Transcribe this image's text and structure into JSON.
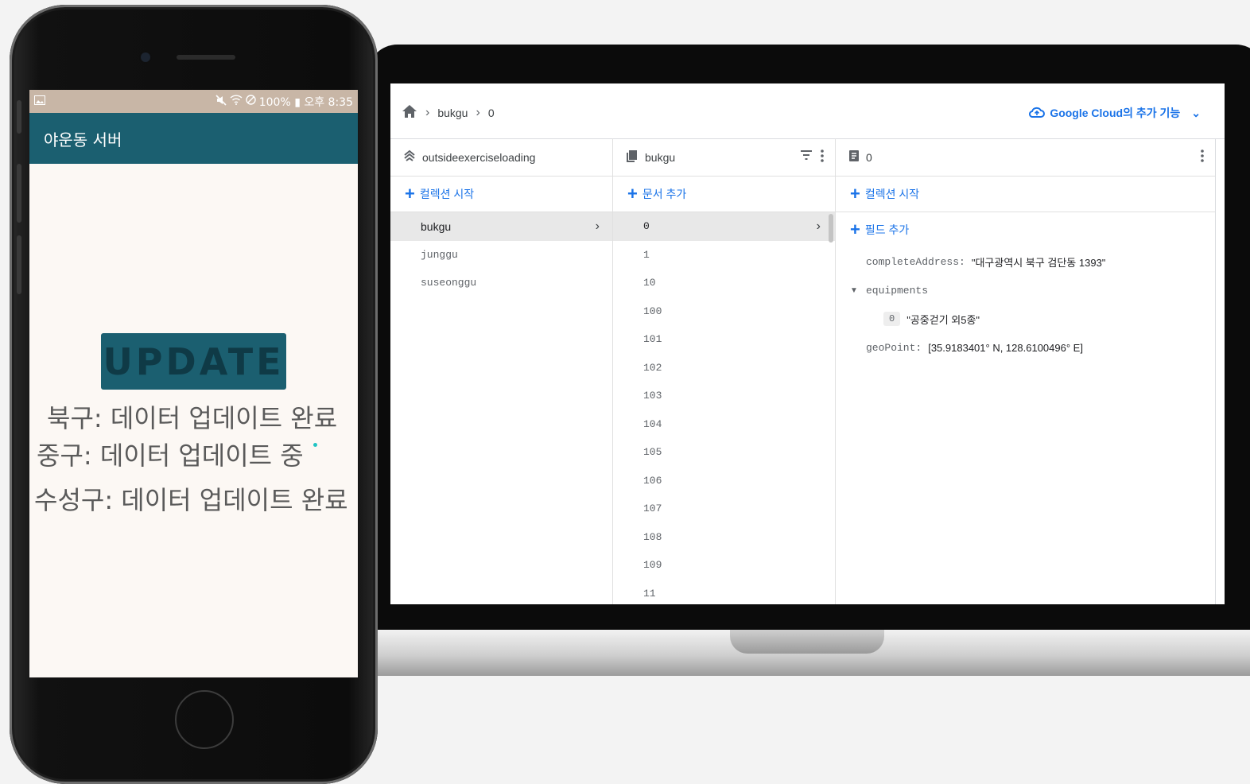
{
  "phone": {
    "status_left_icon": "image-icon",
    "status_text": "100% ▮ 오후 8:35",
    "status_icons": [
      "mute-icon",
      "wifi-icon",
      "block-icon"
    ],
    "app_title": "야운동 서버",
    "update_button": "UPDATE",
    "status_lines": [
      "북구: 데이터 업데이트 완료",
      "중구: 데이터 업데이트 중",
      "수성구: 데이터 업데이트 완료"
    ]
  },
  "console": {
    "breadcrumb": [
      "bukgu",
      "0"
    ],
    "google_cloud_link": "Google Cloud의 추가 기능",
    "panel_root": {
      "title": "outsideexerciseloading",
      "add_label": "컬렉션 시작",
      "items": [
        "bukgu",
        "junggu",
        "suseonggu"
      ],
      "selected": "bukgu"
    },
    "panel_collection": {
      "title": "bukgu",
      "add_label": "문서 추가",
      "items": [
        "0",
        "1",
        "10",
        "100",
        "101",
        "102",
        "103",
        "104",
        "105",
        "106",
        "107",
        "108",
        "109",
        "11"
      ],
      "selected": "0"
    },
    "panel_document": {
      "title": "0",
      "add_collection_label": "컬렉션 시작",
      "add_field_label": "필드 추가",
      "fields": {
        "completeAddress_key": "completeAddress:",
        "completeAddress_val": "\"대구광역시 북구 검단동 1393\"",
        "equipments_key": "equipments",
        "equipments_index": "0",
        "equipments_val": "\"공중걷기 외5종\"",
        "geoPoint_key": "geoPoint:",
        "geoPoint_val": "[35.9183401° N, 128.6100496° E]"
      }
    }
  }
}
